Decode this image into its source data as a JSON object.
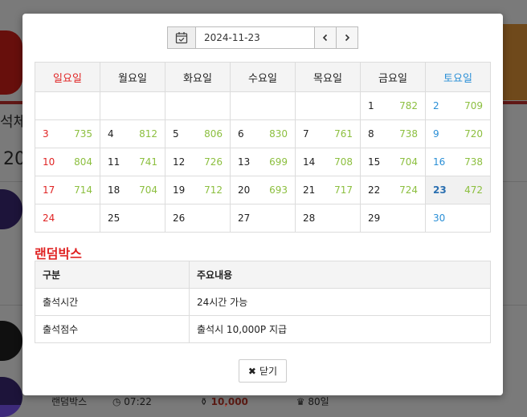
{
  "date_picker": {
    "value": "2024-11-23"
  },
  "calendar": {
    "headers": [
      "일요일",
      "월요일",
      "화요일",
      "수요일",
      "목요일",
      "금요일",
      "토요일"
    ],
    "weeks": [
      [
        {
          "day": "",
          "count": ""
        },
        {
          "day": "",
          "count": ""
        },
        {
          "day": "",
          "count": ""
        },
        {
          "day": "",
          "count": ""
        },
        {
          "day": "",
          "count": ""
        },
        {
          "day": "1",
          "count": "782"
        },
        {
          "day": "2",
          "count": "709"
        }
      ],
      [
        {
          "day": "3",
          "count": "735"
        },
        {
          "day": "4",
          "count": "812"
        },
        {
          "day": "5",
          "count": "806"
        },
        {
          "day": "6",
          "count": "830"
        },
        {
          "day": "7",
          "count": "761"
        },
        {
          "day": "8",
          "count": "738"
        },
        {
          "day": "9",
          "count": "720"
        }
      ],
      [
        {
          "day": "10",
          "count": "804"
        },
        {
          "day": "11",
          "count": "741"
        },
        {
          "day": "12",
          "count": "726"
        },
        {
          "day": "13",
          "count": "699"
        },
        {
          "day": "14",
          "count": "708"
        },
        {
          "day": "15",
          "count": "704"
        },
        {
          "day": "16",
          "count": "738"
        }
      ],
      [
        {
          "day": "17",
          "count": "714"
        },
        {
          "day": "18",
          "count": "704"
        },
        {
          "day": "19",
          "count": "712"
        },
        {
          "day": "20",
          "count": "693"
        },
        {
          "day": "21",
          "count": "717"
        },
        {
          "day": "22",
          "count": "724"
        },
        {
          "day": "23",
          "count": "472",
          "today": true
        }
      ],
      [
        {
          "day": "24",
          "count": ""
        },
        {
          "day": "25",
          "count": ""
        },
        {
          "day": "26",
          "count": ""
        },
        {
          "day": "27",
          "count": ""
        },
        {
          "day": "28",
          "count": ""
        },
        {
          "day": "29",
          "count": ""
        },
        {
          "day": "30",
          "count": ""
        }
      ]
    ]
  },
  "info": {
    "title": "랜덤박스",
    "headers": [
      "구분",
      "주요내용"
    ],
    "rows": [
      [
        "출석시간",
        "24시간 가능"
      ],
      [
        "출석점수",
        "출석시 10,000P 지급"
      ]
    ]
  },
  "buttons": {
    "close": "닫기"
  },
  "background": {
    "tab_text": "석체",
    "year_text": "20",
    "bottom_name": "랜덤박스",
    "bottom_time": "07:22",
    "bottom_points": "10,000",
    "bottom_days": "80일"
  },
  "colors": {
    "sunday": "#e02424",
    "saturday": "#2a8fd6",
    "count": "#8cbf3f",
    "title": "#e02424"
  }
}
